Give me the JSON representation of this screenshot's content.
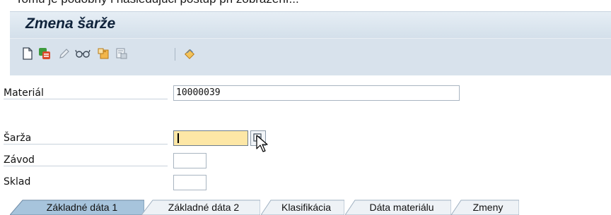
{
  "top_text": "Tomu je podobný i nasledujúci postup pri zobrazení...",
  "window": {
    "title": "Zmena šarže"
  },
  "toolbar": {
    "icons": [
      "new-document-icon",
      "other-batch-icon",
      "change-icon",
      "display-icon",
      "create-icon",
      "archive-icon",
      "where-used-icon"
    ]
  },
  "form": {
    "material": {
      "label": "Materiál",
      "value": "10000039"
    },
    "batch": {
      "label": "Šarža",
      "value": ""
    },
    "plant": {
      "label": "Závod",
      "value": ""
    },
    "storage": {
      "label": "Sklad",
      "value": ""
    }
  },
  "tabs": [
    {
      "label": "Základné dáta 1",
      "active": true
    },
    {
      "label": "Základné dáta 2",
      "active": false
    },
    {
      "label": "Klasifikácia",
      "active": false
    },
    {
      "label": "Dáta materiálu",
      "active": false
    },
    {
      "label": "Zmeny",
      "active": false
    }
  ],
  "colors": {
    "titlebar": "#dbe5ef",
    "toolbar": "#d8e2ec",
    "active_field": "#fde7a6",
    "active_tab": "#a7c4dc",
    "inactive_tab": "#eef2f6"
  }
}
